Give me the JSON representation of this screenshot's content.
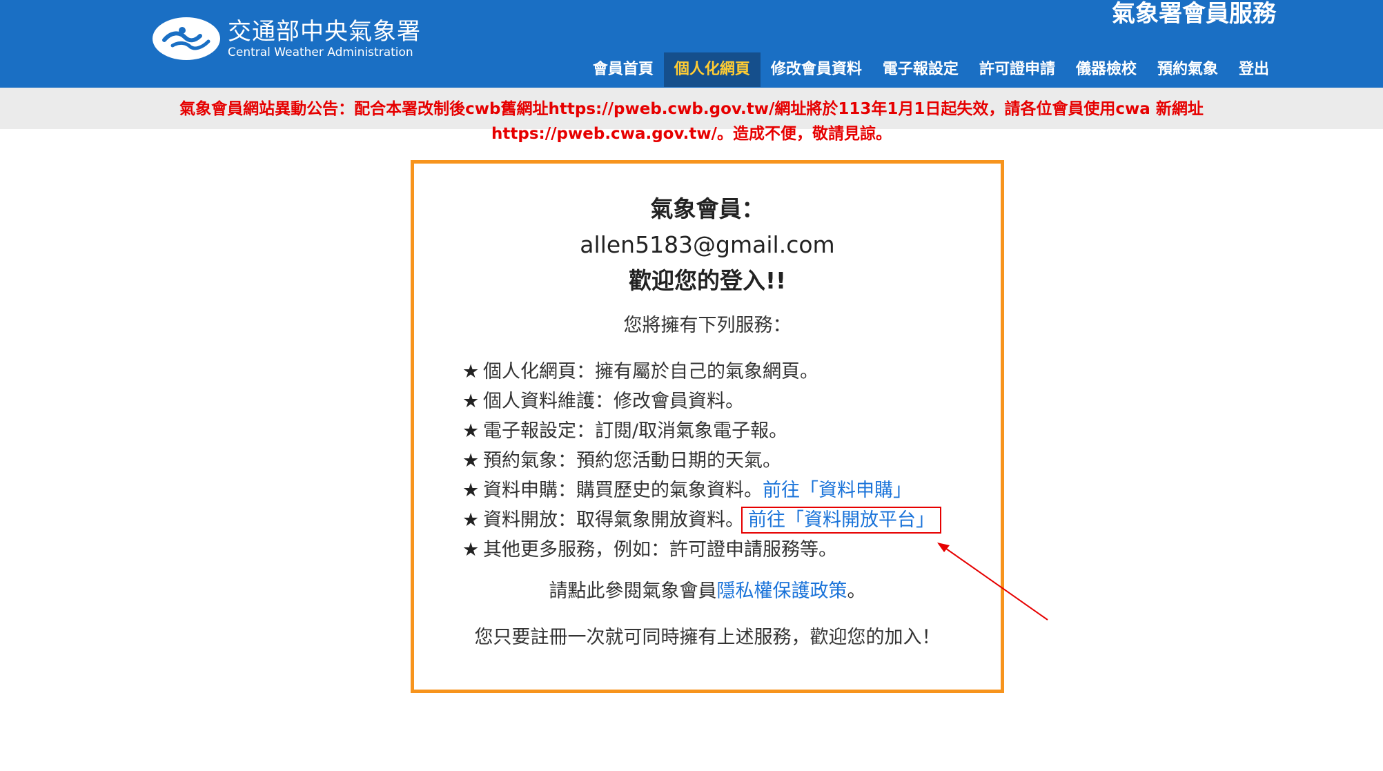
{
  "header": {
    "logo_cn": "交通部中央氣象署",
    "logo_en": "Central Weather Administration",
    "site_title": "氣象署會員服務",
    "nav": [
      {
        "label": "會員首頁",
        "active": false
      },
      {
        "label": "個人化網頁",
        "active": true
      },
      {
        "label": "修改會員資料",
        "active": false
      },
      {
        "label": "電子報設定",
        "active": false
      },
      {
        "label": "許可證申請",
        "active": false
      },
      {
        "label": "儀器檢校",
        "active": false
      },
      {
        "label": "預約氣象",
        "active": false
      },
      {
        "label": "登出",
        "active": false
      }
    ]
  },
  "notice": {
    "line1": "氣象會員網站異動公告：配合本署改制後cwb舊網址https://pweb.cwb.gov.tw/網址將於113年1月1日起失效，請各位會員使用cwa 新網址",
    "line2": "https://pweb.cwa.gov.tw/。造成不便，敬請見諒。"
  },
  "welcome": {
    "member_label": "氣象會員：",
    "email": "allen5183@gmail.com",
    "greeting": "歡迎您的登入!!"
  },
  "services": {
    "intro": "您將擁有下列服務：",
    "star": "★",
    "items": [
      {
        "text": "個人化網頁：擁有屬於自己的氣象網頁。",
        "link": ""
      },
      {
        "text": "個人資料維護：修改會員資料。",
        "link": ""
      },
      {
        "text": "電子報設定：訂閱/取消氣象電子報。",
        "link": ""
      },
      {
        "text": "預約氣象：預約您活動日期的天氣。",
        "link": ""
      },
      {
        "text": "資料申購：購買歷史的氣象資料。",
        "link": "前往「資料申購」"
      },
      {
        "text": "資料開放：取得氣象開放資料。",
        "link": "前往「資料開放平台」"
      },
      {
        "text": "其他更多服務，例如：許可證申請服務等。",
        "link": ""
      }
    ]
  },
  "privacy": {
    "prefix": "請點此參閱氣象會員",
    "link": "隱私權保護政策",
    "suffix": "。"
  },
  "closing": "您只要註冊一次就可同時擁有上述服務，歡迎您的加入！",
  "colors": {
    "header_bg": "#1a6fc4",
    "nav_active_bg": "#154f8c",
    "nav_active_text": "#ffcc33",
    "notice_text": "#e60000",
    "card_border": "#f7941d",
    "link": "#1a73d9",
    "annotation": "#e60000"
  },
  "icons": {
    "logo": "cwa-logo-icon",
    "annotation": "red-arrow-icon"
  }
}
